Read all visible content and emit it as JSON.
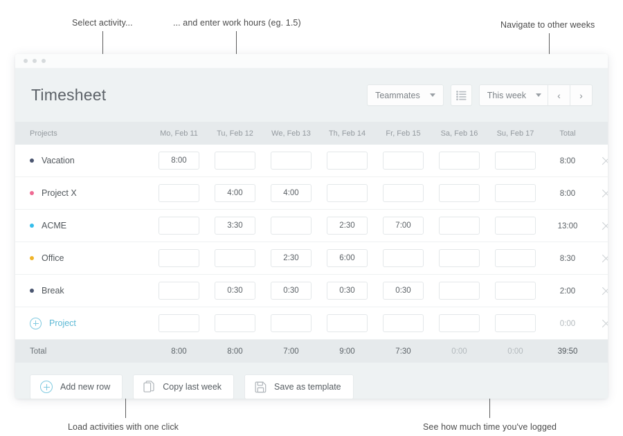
{
  "annotations": [
    {
      "id": "select-activity",
      "text": "Select activity..."
    },
    {
      "id": "enter-hours",
      "text": "... and enter work hours (eg. 1.5)"
    },
    {
      "id": "navigate-weeks",
      "text": "Navigate to other weeks"
    },
    {
      "id": "load-activities",
      "text": "Load activities with one click"
    },
    {
      "id": "time-logged",
      "text": "See how much time you've logged"
    }
  ],
  "window": {
    "title_dots": 3
  },
  "header": {
    "title": "Timesheet",
    "teammates_label": "Teammates",
    "list_icon": "list-view-icon",
    "week_label": "This week",
    "prev_label": "‹",
    "next_label": "›"
  },
  "table": {
    "columns": [
      "Projects",
      "Mo, Feb 11",
      "Tu, Feb 12",
      "We, Feb 13",
      "Th, Feb 14",
      "Fr, Feb 15",
      "Sa, Feb 16",
      "Su, Feb 17",
      "Total"
    ],
    "rows": [
      {
        "name": "Vacation",
        "color": "#4a5570",
        "values": [
          "8:00",
          "",
          "",
          "",
          "",
          "",
          ""
        ],
        "total": "8:00"
      },
      {
        "name": "Project X",
        "color": "#ef6a93",
        "values": [
          "",
          "4:00",
          "4:00",
          "",
          "",
          "",
          ""
        ],
        "total": "8:00"
      },
      {
        "name": "ACME",
        "color": "#35bdeb",
        "values": [
          "",
          "3:30",
          "",
          "2:30",
          "7:00",
          "",
          ""
        ],
        "total": "13:00"
      },
      {
        "name": "Office",
        "color": "#f0b429",
        "values": [
          "",
          "",
          "2:30",
          "6:00",
          "",
          "",
          ""
        ],
        "total": "8:30"
      },
      {
        "name": "Break",
        "color": "#4a5570",
        "values": [
          "",
          "0:30",
          "0:30",
          "0:30",
          "0:30",
          "",
          ""
        ],
        "total": "2:00"
      }
    ],
    "add_row": {
      "label": "Project",
      "values": [
        "",
        "",
        "",
        "",
        "",
        "",
        ""
      ],
      "total": "0:00"
    },
    "footer": {
      "label": "Total",
      "values": [
        "8:00",
        "8:00",
        "7:00",
        "9:00",
        "7:30",
        "0:00",
        "0:00"
      ],
      "muted_index": [
        5,
        6
      ],
      "grand_total": "39:50"
    }
  },
  "actions": [
    {
      "id": "add-new-row",
      "label": "Add new row",
      "icon": "plus-circle-icon"
    },
    {
      "id": "copy-last-week",
      "label": "Copy last week",
      "icon": "copy-icon"
    },
    {
      "id": "save-as-template",
      "label": "Save as template",
      "icon": "floppy-disk-icon"
    }
  ],
  "colors": {
    "accent": "#5bb8d4",
    "app_bg": "#eef2f3",
    "header_bg": "#e6eaec"
  }
}
